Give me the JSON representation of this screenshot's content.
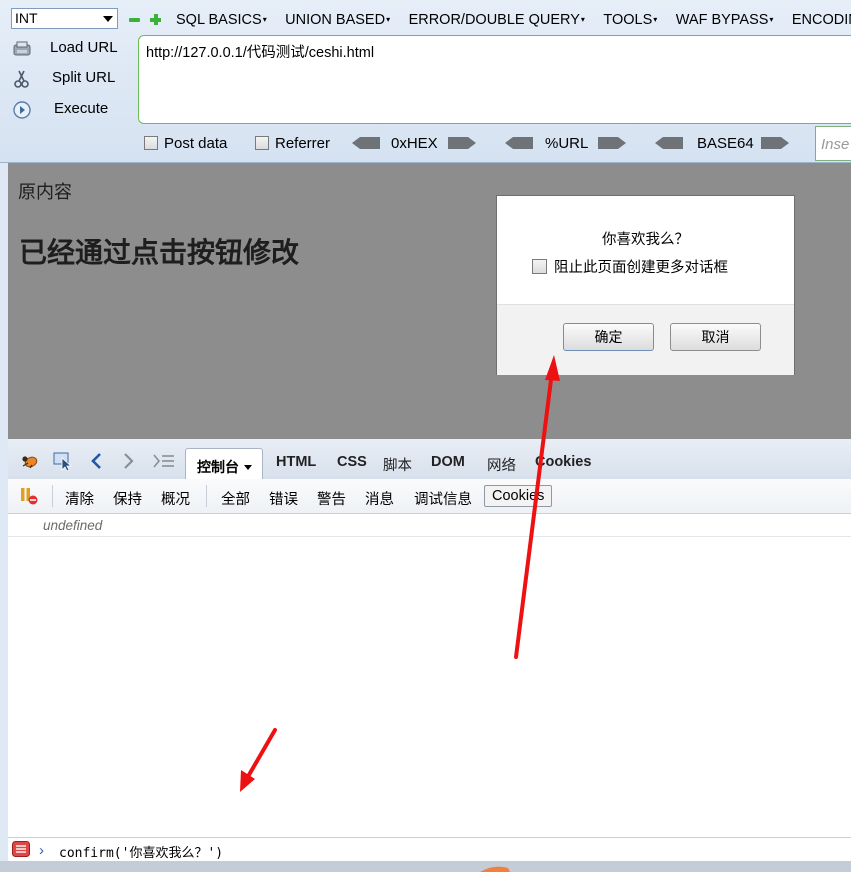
{
  "hackbar": {
    "type_select": "INT",
    "menus": [
      "SQL BASICS",
      "UNION BASED",
      "ERROR/DOUBLE QUERY",
      "TOOLS",
      "WAF BYPASS",
      "ENCODIN"
    ],
    "load_url": "Load URL",
    "split_url": "Split URL",
    "execute": "Execute",
    "url_value": "http://127.0.0.1/代码测试/ceshi.html",
    "post_data": "Post data",
    "referrer": "Referrer",
    "hex": "0xHEX",
    "url_enc": "%URL",
    "base64": "BASE64",
    "insert_placeholder": "Inse"
  },
  "page": {
    "original": "原内容",
    "modified": "已经通过点击按钮修改"
  },
  "dialog": {
    "message": "你喜欢我么？",
    "prevent_label": "阻止此页面创建更多对话框",
    "ok": "确定",
    "cancel": "取消"
  },
  "firebug": {
    "tabs": {
      "console": "控制台",
      "html": "HTML",
      "css": "CSS",
      "script": "脚本",
      "dom": "DOM",
      "net": "网络",
      "cookies": "Cookies"
    },
    "toolbar": {
      "clear": "清除",
      "persist": "保持",
      "profile": "概况",
      "all": "全部",
      "errors": "错误",
      "warnings": "警告",
      "info": "消息",
      "debug": "调试信息",
      "cookies": "Cookies"
    },
    "output": "undefined",
    "command": "confirm('你喜欢我么？')"
  },
  "colors": {
    "annotation_arrow": "#ee1111",
    "page_background": "#8d8d8d",
    "url_border": "#6bbd55"
  }
}
